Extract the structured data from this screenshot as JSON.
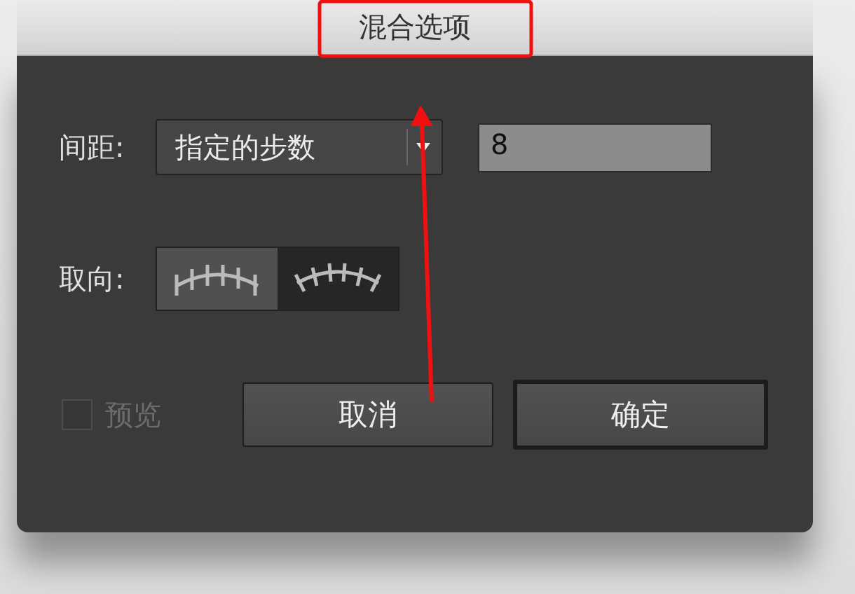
{
  "window": {
    "title": "混合选项"
  },
  "spacing": {
    "label": "间距:",
    "value": "指定的步数",
    "steps": "8"
  },
  "orientation": {
    "label": "取向:",
    "options": [
      {
        "kind": "page",
        "selected": true
      },
      {
        "kind": "path",
        "selected": false
      }
    ]
  },
  "preview": {
    "label": "预览",
    "checked": false,
    "disabled": true
  },
  "buttons": [
    {
      "label": "取消",
      "default": false
    },
    {
      "label": "确定",
      "default": true
    }
  ]
}
